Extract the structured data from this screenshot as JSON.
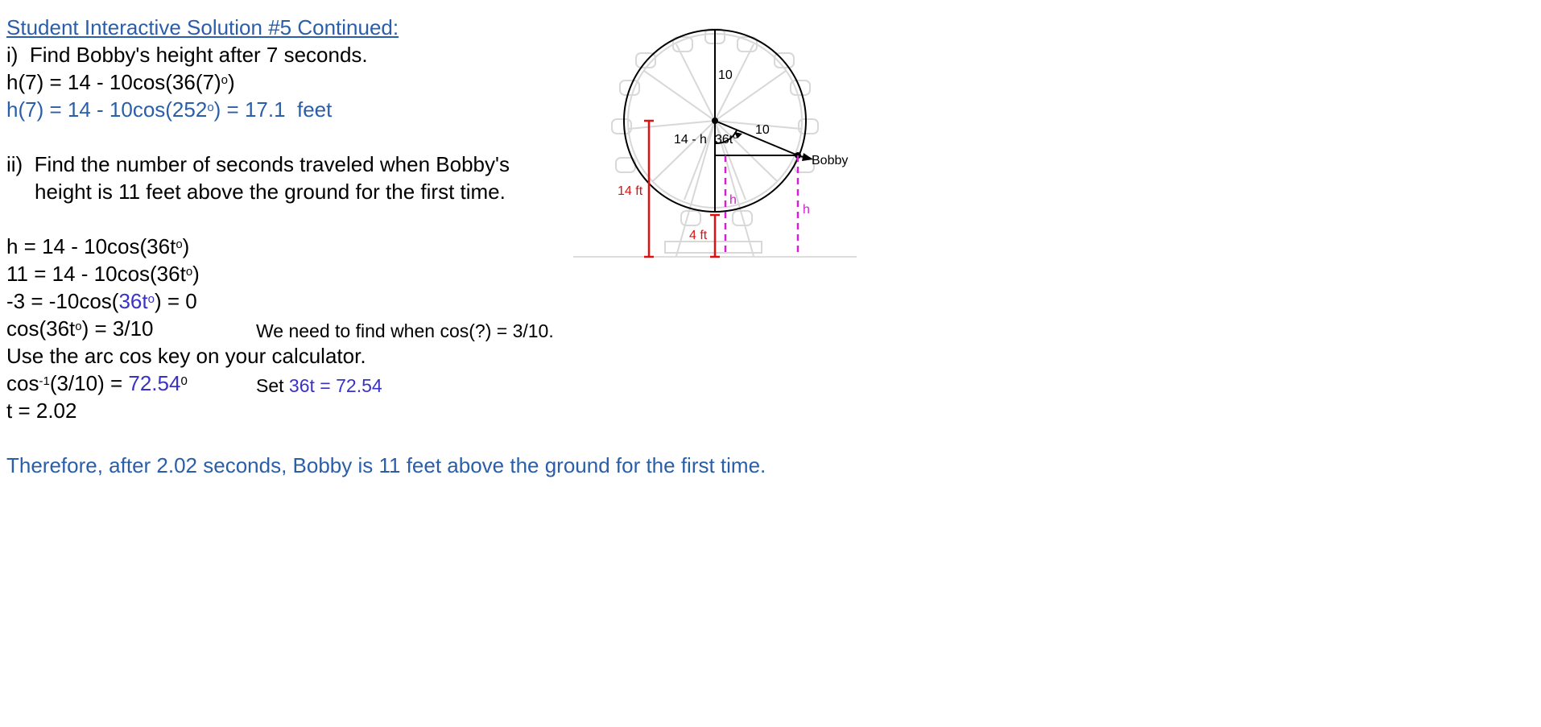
{
  "title": "Student Interactive Solution #5 Continued:",
  "part_i": {
    "question": "i)  Find Bobby's height after 7 seconds.",
    "step1_lhs": "h(7) = 14 - 10cos(36(7)",
    "step1_deg": "o",
    "step1_end": ")",
    "step2_lhs": "h(7) = 14 - 10cos(252",
    "step2_deg": "o",
    "step2_end": ") = 17.1  feet"
  },
  "part_ii": {
    "question_line1": "ii)  Find the number of seconds traveled when Bobby's",
    "question_line2": "height is 11 feet above the ground for the first time.",
    "eq1_a": "h = 14 - 10cos(36t",
    "eq1_deg": "o",
    "eq1_b": ")",
    "eq2_a": "11 = 14 - 10cos(36t",
    "eq2_deg": "o",
    "eq2_b": ")",
    "eq3_a": "-3 = -10cos(",
    "eq3_blue": "36t",
    "eq3_deg": "o",
    "eq3_b": ") = 0",
    "eq4_a": "cos(36t",
    "eq4_deg": "o",
    "eq4_b": ") = 3/10",
    "note1": "We need to find when cos(?) = 3/10.",
    "instruction": "Use the arc cos key on your calculator.",
    "eq5_a": "cos",
    "eq5_sup": "-1",
    "eq5_b": "(3/10) = ",
    "eq5_val": "72.54",
    "eq5_deg": "0",
    "note2_a": "Set ",
    "note2_b": "36t = 72.54",
    "eq6": "t = 2.02",
    "conclusion": "Therefore, after 2.02 seconds, Bobby is 11 feet above the ground for the first time."
  },
  "diagram": {
    "label_radius_top": "10",
    "label_radius_side": "10",
    "label_center_offset": "14 - h",
    "label_angle": "36t",
    "label_angle_deg": "o",
    "label_bobby": "Bobby",
    "label_h_inner": "h",
    "label_h_outer": "h",
    "label_14ft": "14 ft",
    "label_4ft": "4 ft",
    "colors": {
      "red": "#e01010",
      "magenta": "#d020d0",
      "blue_text": "#2b5ea8",
      "purple_text": "#3a32c8"
    }
  }
}
